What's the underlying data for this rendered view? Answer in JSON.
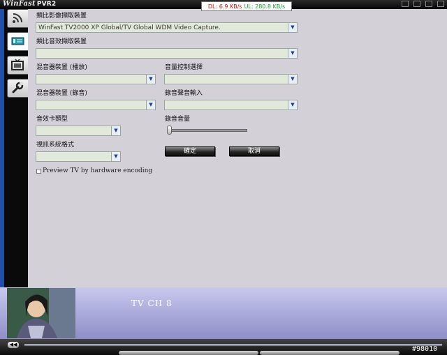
{
  "app": {
    "logo_text": "WinFast",
    "logo_suffix": "PVR2"
  },
  "speed": {
    "dl": "DL: 6.9 KB/s",
    "ul": "UL: 280.8 KB/s"
  },
  "tabs": [
    {
      "name": "rss-icon"
    },
    {
      "name": "capture-device-icon"
    },
    {
      "name": "tv-icon"
    },
    {
      "name": "wrench-icon"
    }
  ],
  "form": {
    "video_capture_label": "類比影像擷取裝置",
    "video_capture_value": "WinFast TV2000 XP Global/TV Global WDM Video Capture.",
    "audio_capture_label": "類比音效擷取裝置",
    "audio_capture_value": "",
    "mixer_play_label": "混音器裝置 (播放)",
    "mixer_play_value": "",
    "volume_control_label": "音量控制選擇",
    "volume_control_value": "",
    "mixer_record_label": "混音器裝置 (錄音)",
    "mixer_record_value": "",
    "record_input_label": "錄音聲音輸入",
    "record_input_value": "",
    "soundcard_type_label": "音效卡類型",
    "soundcard_type_value": "",
    "record_volume_label": "錄音音量",
    "record_volume_level": 0,
    "video_format_label": "視訊系統格式",
    "video_format_value": "",
    "ok_label": "確定",
    "cancel_label": "取消",
    "preview_label": "Preview TV by hardware encoding",
    "preview_checked": false
  },
  "video": {
    "channel_label": "TV CH 8"
  },
  "watermark": "#98010",
  "colors": {
    "panel": "#d4d0d8",
    "combo": "#e2e9da",
    "video_bar": "#a8a8dc",
    "dl": "#d01010",
    "ul": "#10a030"
  }
}
